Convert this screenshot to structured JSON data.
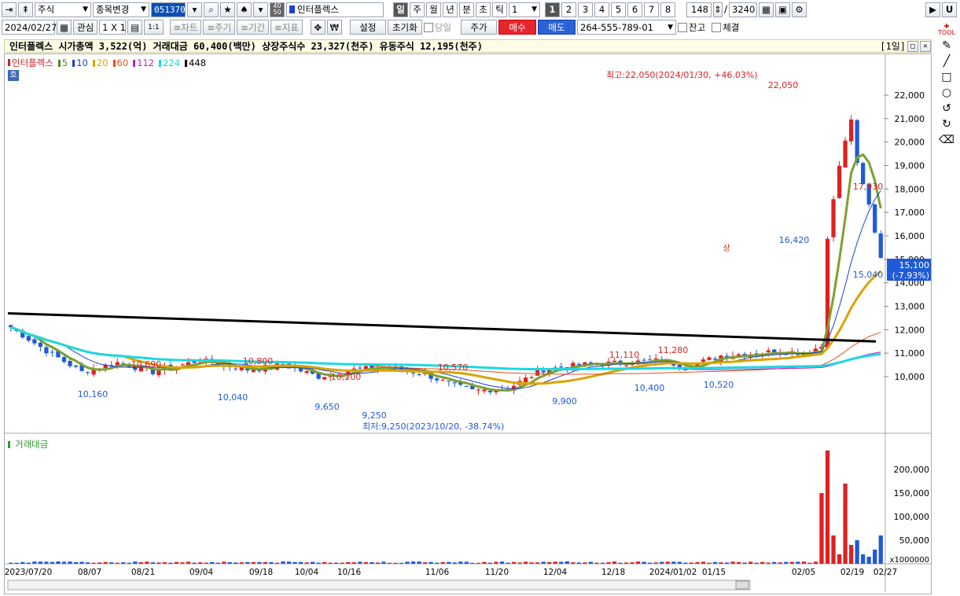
{
  "toolbar1": {
    "market": "주식",
    "change": "종목변경",
    "code": "051370",
    "name": "인터플렉스",
    "periods": [
      "일",
      "주",
      "월",
      "년",
      "분",
      "초",
      "틱"
    ],
    "period_active": "일",
    "interval": "1",
    "counts": [
      "1",
      "2",
      "3",
      "4",
      "5",
      "6",
      "7",
      "8"
    ],
    "count_active": "1",
    "view_count": "148",
    "total_count": "3240",
    "btn_right": "U"
  },
  "toolbar2": {
    "date": "2024/02/27",
    "watch": "관심",
    "grid": "1 X 1",
    "grid2": "1:1",
    "chart": "≡차트",
    "period": "≡주기",
    "range": "≡기간",
    "index": "≡지표",
    "setting": "설정",
    "reset": "초기화",
    "today": "당일",
    "price": "주가",
    "buy": "매수",
    "sell": "매도",
    "account": "264-555-789-01",
    "balance": "잔고",
    "filled": "체결"
  },
  "info": {
    "text": "인터플렉스  시가총액 3,522(억)  거래대금 60,400(백만)  상장주식수 23,327(천주)  유동주식 12,195(천주)",
    "page": "[1일]"
  },
  "legend": {
    "name": "인터플렉스",
    "ma": [
      {
        "label": "5",
        "color": "#4a8c1c"
      },
      {
        "label": "10",
        "color": "#1b3fd6"
      },
      {
        "label": "20",
        "color": "#d8a400"
      },
      {
        "label": "60",
        "color": "#e0501a"
      },
      {
        "label": "112",
        "color": "#c020c0"
      },
      {
        "label": "224",
        "color": "#1cd8e0"
      },
      {
        "label": "448",
        "color": "#000000"
      }
    ],
    "ho": "호"
  },
  "vol_legend": "거래대금",
  "chart_data": {
    "type": "candlestick",
    "price_ticks": [
      "22,000",
      "21,000",
      "20,000",
      "19,000",
      "18,000",
      "17,000",
      "16,000",
      "15,000",
      "14,000",
      "13,000",
      "12,000",
      "11,000",
      "10,000"
    ],
    "vol_ticks": [
      "200,000",
      "150,000",
      "100,000",
      "50,000"
    ],
    "vol_unit": "x1000000",
    "x_labels": [
      "2023/07/20",
      "08/07",
      "08/21",
      "09/04",
      "09/18",
      "10/04",
      "10/16",
      "11/06",
      "11/20",
      "12/04",
      "12/18",
      "2024/01/02",
      "01/15",
      "02/05",
      "02/19",
      "02/27"
    ],
    "annotations": {
      "high": "최고:22,050(2024/01/30, +46.03%)",
      "high_val": "22,050",
      "low": "최저:9,250(2023/10/20, -38.74%)",
      "low_val": "9,250",
      "labels": [
        {
          "t": "10,690",
          "c": "red"
        },
        {
          "t": "10,800",
          "c": "red"
        },
        {
          "t": "10,200",
          "c": "red"
        },
        {
          "t": "10,570",
          "c": "red"
        },
        {
          "t": "11,110",
          "c": "red"
        },
        {
          "t": "11,280",
          "c": "red"
        },
        {
          "t": "17,930",
          "c": "red"
        },
        {
          "t": "10,160",
          "c": "blue"
        },
        {
          "t": "10,040",
          "c": "blue"
        },
        {
          "t": "9,650",
          "c": "blue"
        },
        {
          "t": "9,900",
          "c": "blue"
        },
        {
          "t": "10,400",
          "c": "blue"
        },
        {
          "t": "10,520",
          "c": "blue"
        },
        {
          "t": "16,420",
          "c": "blue"
        },
        {
          "t": "15,040",
          "c": "blue"
        }
      ],
      "limit_up": "상",
      "current": "15,100",
      "current_pct": "(-7.93%)"
    }
  }
}
